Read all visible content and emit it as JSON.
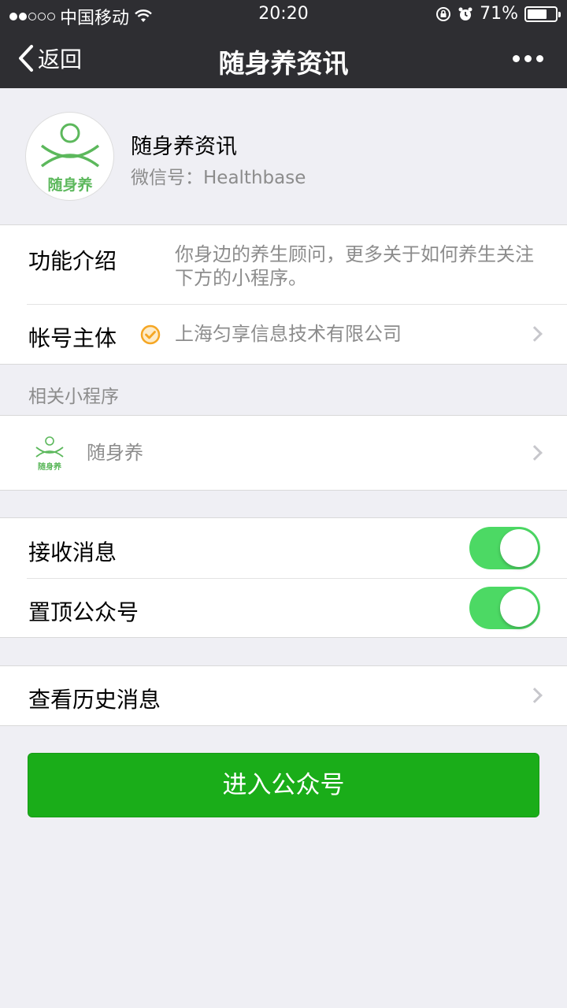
{
  "status_bar": {
    "carrier": "中国移动",
    "time": "20:20",
    "battery_percent": "71%",
    "battery_level": 0.71,
    "signal_bars": 2,
    "icons": [
      "wifi-icon",
      "orientation-lock-icon",
      "alarm-icon",
      "battery-icon"
    ]
  },
  "nav": {
    "back_label": "返回",
    "title": "随身养资讯",
    "more_icon": "more-dots-icon"
  },
  "profile": {
    "name": "随身养资讯",
    "wechat_id": "微信号：Healthbase",
    "logo_text": "随身养"
  },
  "info": {
    "intro_label": "功能介绍",
    "intro_value": "你身边的养生顾问，更多关于如何养生关注下方的小程序。",
    "owner_label": "帐号主体",
    "owner_value": "上海匀享信息技术有限公司",
    "verified_icon": "verified-check-icon"
  },
  "mini_programs": {
    "header": "相关小程序",
    "items": [
      {
        "name": "随身养",
        "logo_text": "随身养"
      }
    ]
  },
  "settings": {
    "receive_messages_label": "接收消息",
    "receive_messages_on": true,
    "pin_label": "置顶公众号",
    "pin_on": true
  },
  "history": {
    "label": "查看历史消息"
  },
  "enter_button": {
    "label": "进入公众号"
  },
  "colors": {
    "nav_bg": "#2e2e32",
    "page_bg": "#efeff4",
    "toggle_on": "#4cd964",
    "primary_button": "#1aad19",
    "logo_green": "#5cb85c",
    "verified_orange": "#f5a623"
  }
}
